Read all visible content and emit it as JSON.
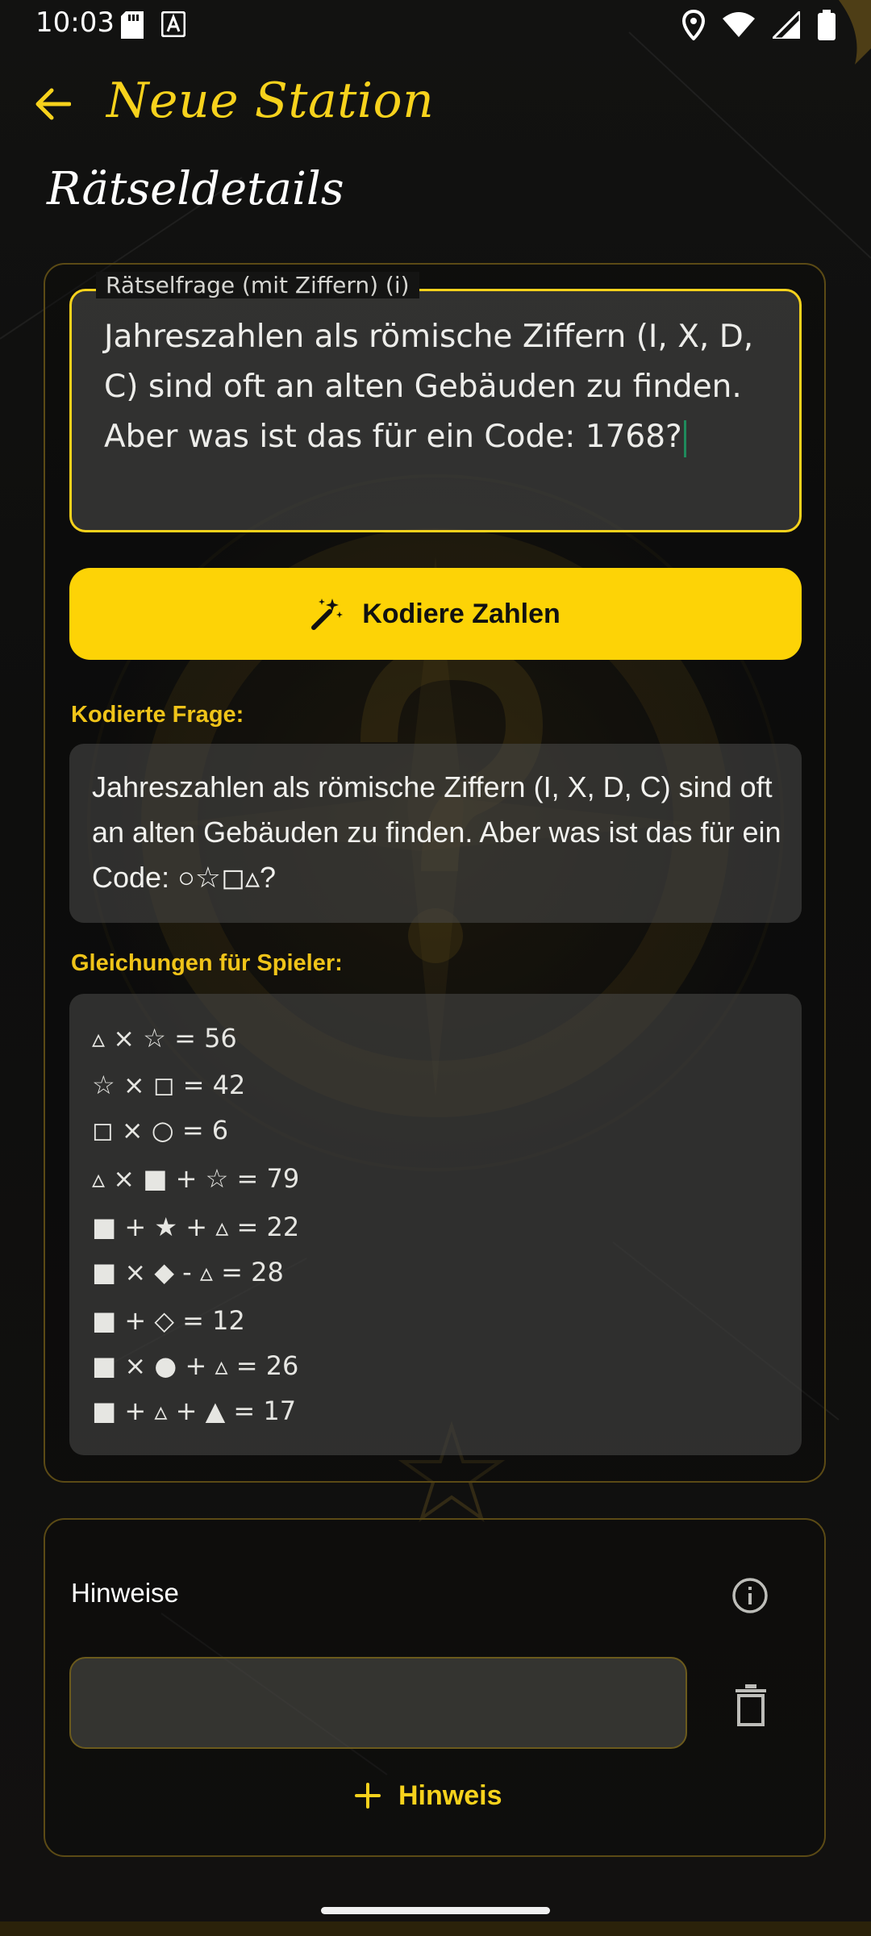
{
  "status_bar": {
    "time": "10:03"
  },
  "app_bar": {
    "title": "Neue Station"
  },
  "section": {
    "heading": "Rätseldetails"
  },
  "question_field": {
    "label": "Rätselfrage (mit Ziffern) (i)",
    "value": "Jahreszahlen als römische Ziffern (I, X, D, C) sind oft an alten Gebäuden zu finden. Aber was ist das für ein Code: 1768?"
  },
  "encode_button": {
    "label": "Kodiere Zahlen"
  },
  "encoded": {
    "label": "Kodierte Frage:",
    "text": "Jahreszahlen als römische Ziffern (I, X, D, C) sind oft an alten Gebäuden zu finden. Aber was ist das für ein Code: ○☆◻▵?"
  },
  "equations": {
    "label": "Gleichungen für Spieler:",
    "items": [
      "▵ × ☆ = 56",
      "☆ × ◻ = 42",
      "◻ × ○ = 6",
      "▵ × ■ + ☆ = 79",
      "■ + ★ + ▵ = 22",
      "■ × ◆ - ▵ = 28",
      "■ + ◇ = 12",
      "■ × ● + ▵ = 26",
      "■ + ▵ + ▲ = 17"
    ]
  },
  "hints": {
    "title": "Hinweise",
    "input_value": "",
    "add_label": "Hinweis"
  },
  "colors": {
    "accent": "#f7d21c",
    "button": "#fdd306",
    "background": "#0d0d0c"
  },
  "icons": {
    "back": "arrow-left-icon",
    "encode": "magic-wand-icon",
    "info": "info-icon",
    "delete": "trash-icon",
    "add": "plus-icon"
  }
}
